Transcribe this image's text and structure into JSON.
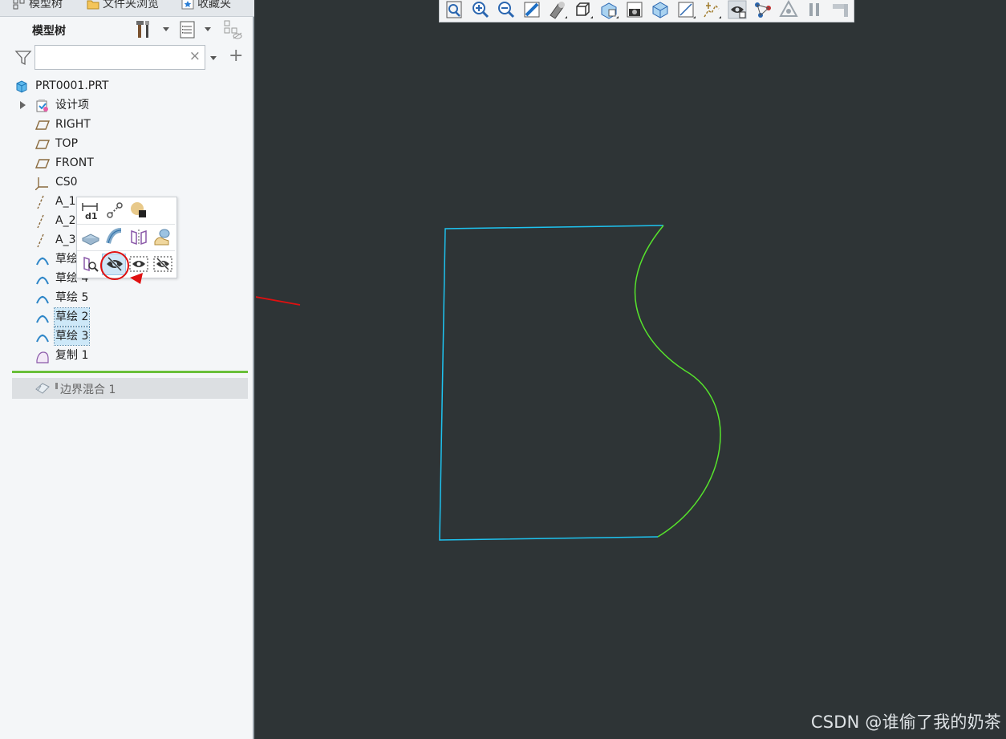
{
  "tabs": [
    {
      "label": "模型树",
      "icon": "model-tree-icon"
    },
    {
      "label": "文件夹浏览",
      "icon": "folder-icon"
    },
    {
      "label": "收藏夹",
      "icon": "favorites-icon"
    }
  ],
  "model_tree": {
    "title": "模型树",
    "toolbar_icons": [
      "settings-tools-icon",
      "show-options-icon",
      "tree-filter-icon"
    ],
    "search": {
      "value": "",
      "placeholder": ""
    },
    "items": [
      {
        "label": "PRT0001.PRT",
        "icon": "part-icon",
        "selected": false
      },
      {
        "label": "设计项",
        "icon": "design-items-icon",
        "selected": false,
        "expandable": true
      },
      {
        "label": "RIGHT",
        "icon": "datum-plane-icon",
        "selected": false
      },
      {
        "label": "TOP",
        "icon": "datum-plane-icon",
        "selected": false
      },
      {
        "label": "FRONT",
        "icon": "datum-plane-icon",
        "selected": false
      },
      {
        "label": "CS0",
        "icon": "coordinate-system-icon",
        "selected": false
      },
      {
        "label": "A_1",
        "icon": "datum-axis-icon",
        "selected": false
      },
      {
        "label": "A_2",
        "icon": "datum-axis-icon",
        "selected": false
      },
      {
        "label": "A_3",
        "icon": "datum-axis-icon",
        "selected": false
      },
      {
        "label": "草绘",
        "icon": "sketch-icon",
        "selected": false
      },
      {
        "label": "草绘 4",
        "icon": "sketch-icon",
        "selected": false
      },
      {
        "label": "草绘 5",
        "icon": "sketch-icon",
        "selected": false
      },
      {
        "label": "草绘 2",
        "icon": "sketch-icon",
        "selected": true
      },
      {
        "label": "草绘 3",
        "icon": "sketch-icon",
        "selected": true
      },
      {
        "label": "复制 1",
        "icon": "copy-surface-icon",
        "selected": false
      }
    ],
    "insert_item": {
      "label": "边界混合 1",
      "icon": "boundary-blend-icon"
    }
  },
  "mini_toolbar": {
    "rows": [
      [
        "edit-dimensions-icon",
        "edit-references-icon",
        "appearance-icon"
      ],
      [
        "extrude-icon",
        "sweep-icon",
        "mirror-icon",
        "surface-icon"
      ],
      [
        "measure-icon",
        "hide-icon",
        "show-icon",
        "hide-all-icon"
      ]
    ],
    "highlighted": "hide-icon"
  },
  "graphics_toolbar": {
    "icons": [
      "refit-icon",
      "zoom-in-icon",
      "zoom-out-icon",
      "repaint-icon",
      "display-style-icon",
      "saved-orientations-icon",
      "named-views-icon",
      "view-manager-icon",
      "perspective-icon",
      "section-icon",
      "datum-display-icon",
      "spin-center-icon",
      "annotation-display-icon",
      "pause-icon",
      "appearance-gallery-icon"
    ]
  },
  "colors": {
    "background": "#2e3436",
    "sketch_blue": "#1ec3f0",
    "sketch_green": "#56e32c",
    "annotation_red": "#e01010",
    "selection": "#cde8f8"
  },
  "watermark": "CSDN @谁偷了我的奶茶"
}
